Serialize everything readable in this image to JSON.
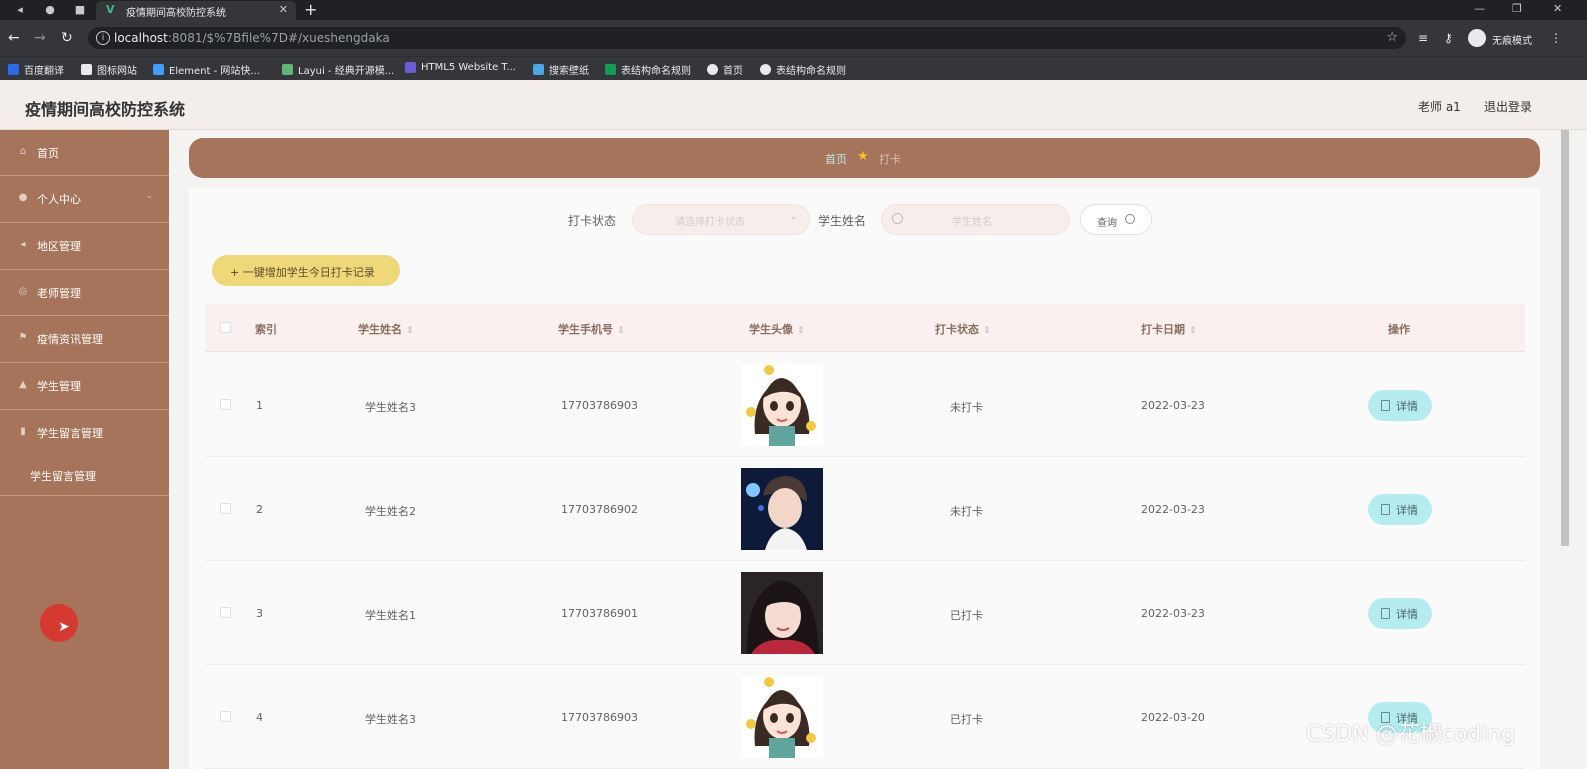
{
  "browser": {
    "tab_title": "疫情期间高校防控系统",
    "address_host": "localhost",
    "address_path": ":8081/$%7Bfile%7D#/xueshengdaka",
    "incognito_label": "无痕模式",
    "bookmarks": [
      {
        "label": "百度翻译",
        "color": "#2a6be8"
      },
      {
        "label": "图标网站",
        "color": "#ffffff"
      },
      {
        "label": "Element - 网站快...",
        "color": "#409eff"
      },
      {
        "label": "Layui - 经典开源模...",
        "color": "#5fb878"
      },
      {
        "label": "HTML5 Website T...",
        "color": "#6b5bd6"
      },
      {
        "label": "搜索壁纸",
        "color": "#4aa8e8"
      },
      {
        "label": "表结构命名规则",
        "color": "#0f9d58"
      },
      {
        "label": "首页",
        "color": "#e8eaed"
      },
      {
        "label": "表结构命名规则",
        "color": "#e8eaed"
      }
    ]
  },
  "header": {
    "title": "疫情期间高校防控系统",
    "user": "老师 a1",
    "logout": "退出登录"
  },
  "sidebar": {
    "items": [
      {
        "label": "首页",
        "icon": "home-icon"
      },
      {
        "label": "个人中心",
        "icon": "user-icon"
      },
      {
        "label": "地区管理",
        "icon": "map-icon"
      },
      {
        "label": "老师管理",
        "icon": "teacher-icon"
      },
      {
        "label": "疫情资讯管理",
        "icon": "flag-icon"
      },
      {
        "label": "学生管理",
        "icon": "student-icon"
      },
      {
        "label": "学生留言管理",
        "icon": "message-icon"
      }
    ],
    "submenu": "学生留言管理"
  },
  "breadcrumb": {
    "home": "首页",
    "current": "打卡"
  },
  "filters": {
    "status_label": "打卡状态",
    "status_placeholder": "请选择打卡状态",
    "name_label": "学生姓名",
    "name_placeholder": "学生姓名",
    "query_button": "查询"
  },
  "actions": {
    "add_button": "+ 一键增加学生今日打卡记录"
  },
  "table": {
    "headers": {
      "index": "索引",
      "name": "学生姓名",
      "phone": "学生手机号",
      "avatar": "学生头像",
      "status": "打卡状态",
      "date": "打卡日期",
      "ops": "操作"
    },
    "rows": [
      {
        "index": "1",
        "name": "学生姓名3",
        "phone": "17703786903",
        "avatar": "cartoon-girl",
        "status": "未打卡",
        "date": "2022-03-23"
      },
      {
        "index": "2",
        "name": "学生姓名2",
        "phone": "17703786902",
        "avatar": "boy-photo",
        "status": "未打卡",
        "date": "2022-03-23"
      },
      {
        "index": "3",
        "name": "学生姓名1",
        "phone": "17703786901",
        "avatar": "girl-photo",
        "status": "已打卡",
        "date": "2022-03-23"
      },
      {
        "index": "4",
        "name": "学生姓名3",
        "phone": "17703786903",
        "avatar": "cartoon-girl",
        "status": "已打卡",
        "date": "2022-03-20"
      }
    ],
    "detail_button": "详情"
  },
  "watermark": "CSDN @花椒coding",
  "colors": {
    "sidebar": "#a5745a",
    "breadcrumb_bar": "#a5745a",
    "add_button": "#efd879",
    "detail_button": "#b4ecef"
  }
}
